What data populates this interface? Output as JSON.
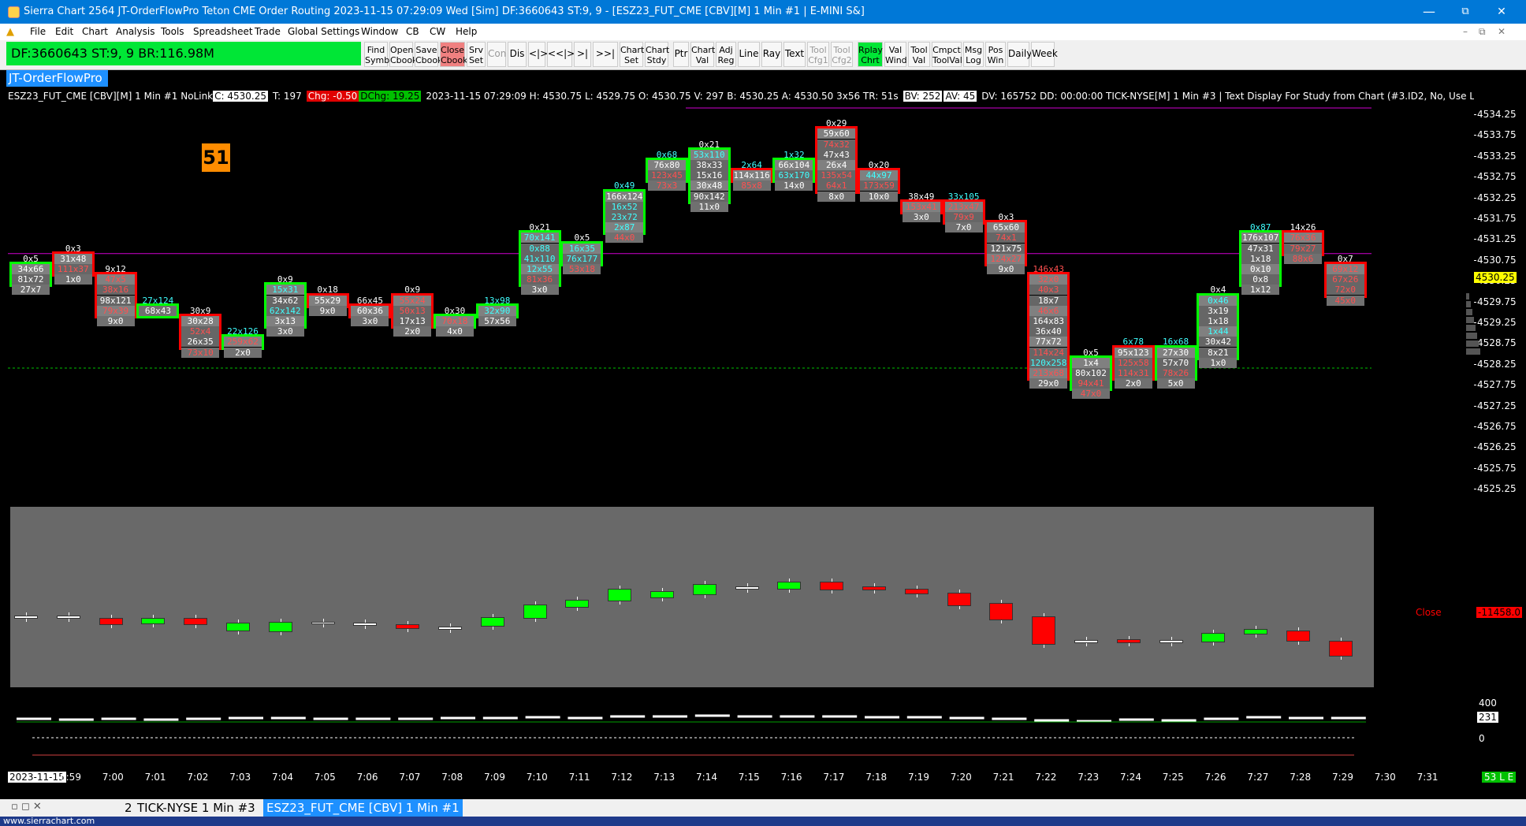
{
  "window": {
    "title": "Sierra Chart 2564 JT-OrderFlowPro Teton CME Order Routing 2023-11-15  07:29:09 Wed [Sim]  DF:3660643  ST:9, 9 - [ESZ23_FUT_CME [CBV][M]  1 Min  #1 | E-MINI S&]",
    "minimize": "—",
    "restore": "⧉",
    "close": "✕"
  },
  "menu": [
    "File",
    "Edit",
    "Chart",
    "Analysis",
    "Tools",
    "Spreadsheet",
    "Trade",
    "Global Settings",
    "Window",
    "CB",
    "CW",
    "Help"
  ],
  "toolbar": {
    "df_status": "DF:3660643  ST:9, 9  BR:116.98M",
    "buttons": [
      {
        "l1": "Find",
        "l2": "Symb"
      },
      {
        "l1": "Open",
        "l2": "Cbook"
      },
      {
        "l1": "Save",
        "l2": "Cbook"
      },
      {
        "l1": "Close",
        "l2": "Cbook"
      },
      {
        "l1": "Srv",
        "l2": "Set"
      },
      {
        "l1": "Con",
        "l2": ""
      },
      {
        "l1": "Dis",
        "l2": ""
      },
      {
        "l1": "<|>",
        "l2": ""
      },
      {
        "l1": "<<|>>",
        "l2": ""
      },
      {
        "l1": ">|<",
        "l2": ""
      },
      {
        "l1": ">>|<<",
        "l2": ""
      },
      {
        "l1": "Chart",
        "l2": "Set"
      },
      {
        "l1": "Chart",
        "l2": "Stdy"
      },
      {
        "l1": "Ptr",
        "l2": ""
      },
      {
        "l1": "Chart",
        "l2": "Val"
      },
      {
        "l1": "Adj",
        "l2": "Reg"
      },
      {
        "l1": "Line",
        "l2": ""
      },
      {
        "l1": "Ray",
        "l2": ""
      },
      {
        "l1": "Text",
        "l2": ""
      },
      {
        "l1": "Tool",
        "l2": "Cfg1"
      },
      {
        "l1": "Tool",
        "l2": "Cfg2"
      },
      {
        "l1": "Rplay",
        "l2": "Chrt"
      },
      {
        "l1": "Val",
        "l2": "Wind"
      },
      {
        "l1": "Tool",
        "l2": "Val"
      },
      {
        "l1": "Cmpct",
        "l2": "ToolVal"
      },
      {
        "l1": "Msg",
        "l2": "Log"
      },
      {
        "l1": "Pos",
        "l2": "Win"
      },
      {
        "l1": "Daily",
        "l2": ""
      },
      {
        "l1": "Week",
        "l2": ""
      }
    ]
  },
  "study_tab": "JT-OrderFlowPro",
  "infobar": {
    "symbol": "ESZ23_FUT_CME [CBV][M]  1 Min  #1 NoLink",
    "c": "C: 4530.25",
    "t": "T: 197",
    "chg": "Chg: -0.50",
    "dchg": "DChg: 19.25",
    "bar": "2023-11-15 07:29:09 H: 4530.75  L: 4529.75  O: 4530.75  V: 297  B: 4530.25  A: 4530.50  3x56  TR: 51s",
    "bv": "BV: 252",
    "av": "AV: 45",
    "rest": "DV: 165752  DD: 00:00:00  TICK-NYSE[M]  1 Min  #3 | Text Display For Study from Chart   (#3.ID2, No, Use Latest Value from"
  },
  "badge": "51",
  "price_axis": [
    "4534.25",
    "4533.75",
    "4533.25",
    "4532.75",
    "4532.25",
    "4531.75",
    "4531.25",
    "4530.75",
    "4530.25",
    "4529.75",
    "4529.25",
    "4528.75",
    "4528.25",
    "4527.75",
    "4527.25",
    "4526.75",
    "4526.25",
    "4525.75",
    "4525.25"
  ],
  "last_price": "4530.25",
  "close_label": "Close",
  "close_value": "-11458.0",
  "lower_axis": [
    "400",
    "231",
    "0"
  ],
  "time_axis": [
    "2023-11-15",
    "6:59",
    "7:00",
    "7:01",
    "7:02",
    "7:03",
    "7:04",
    "7:05",
    "7:06",
    "7:07",
    "7:08",
    "7:09",
    "7:10",
    "7:11",
    "7:12",
    "7:13",
    "7:14",
    "7:15",
    "7:16",
    "7:17",
    "7:18",
    "7:19",
    "7:20",
    "7:21",
    "7:22",
    "7:23",
    "7:24",
    "7:25",
    "7:26",
    "7:27",
    "7:28",
    "7:29",
    "7:30",
    "7:31"
  ],
  "time_badge": "53 L E",
  "tabs": [
    "2",
    "TICK-NYSE  1 Min  #3",
    "ESZ23_FUT_CME [CBV]  1 Min  #1"
  ],
  "status": "www.sierrachart.com",
  "colors": {
    "up": "#00ff00",
    "down": "#ff0000",
    "magenta": "#d000d0",
    "vwap": "#00c000"
  },
  "chart_data": {
    "type": "footprint",
    "bars": [
      {
        "time": "6:58",
        "dir": "up",
        "cells": [
          "0x5",
          "34x66",
          "81x72",
          "27x7"
        ]
      },
      {
        "time": "6:59",
        "dir": "down",
        "cells": [
          "0x3",
          "31x48",
          "111x37",
          "1x0"
        ]
      },
      {
        "time": "7:00",
        "dir": "down",
        "cells": [
          "9x12",
          "47x5",
          "38x16",
          "98x121",
          "79x39",
          "9x0"
        ]
      },
      {
        "time": "7:01",
        "dir": "up",
        "cells": [
          "27x124",
          "68x43"
        ]
      },
      {
        "time": "7:02",
        "dir": "down",
        "cells": [
          "30x9",
          "30x28",
          "52x4",
          "26x35",
          "73x10"
        ]
      },
      {
        "time": "7:03",
        "dir": "up",
        "cells": [
          "22x126",
          "259x62",
          "2x0"
        ]
      },
      {
        "time": "7:04",
        "dir": "up",
        "cells": [
          "0x9",
          "15x31",
          "34x62",
          "62x142",
          "3x13",
          "3x0"
        ]
      },
      {
        "time": "7:05",
        "dir": "down",
        "cells": [
          "0x18",
          "55x29",
          "9x0"
        ]
      },
      {
        "time": "7:06",
        "dir": "down",
        "cells": [
          "66x45",
          "60x36",
          "3x0"
        ]
      },
      {
        "time": "7:07",
        "dir": "down",
        "cells": [
          "0x9",
          "55x24",
          "50x13",
          "17x13",
          "2x0"
        ]
      },
      {
        "time": "7:08",
        "dir": "up",
        "cells": [
          "0x30",
          "70x18",
          "4x0"
        ]
      },
      {
        "time": "7:09",
        "dir": "up",
        "cells": [
          "13x98",
          "32x90",
          "57x56"
        ]
      },
      {
        "time": "7:10",
        "dir": "up",
        "cells": [
          "0x21",
          "70x141",
          "0x88",
          "41x110",
          "12x55",
          "81x36",
          "3x0"
        ]
      },
      {
        "time": "7:11",
        "dir": "up",
        "cells": [
          "0x5",
          "16x35",
          "76x177",
          "53x18"
        ]
      },
      {
        "time": "7:12",
        "dir": "up",
        "cells": [
          "0x49",
          "166x124",
          "16x52",
          "23x72",
          "2x87",
          "44x0"
        ]
      },
      {
        "time": "7:13",
        "dir": "up",
        "cells": [
          "0x68",
          "76x80",
          "123x45",
          "73x3"
        ]
      },
      {
        "time": "7:14",
        "dir": "up",
        "cells": [
          "0x21",
          "53x110",
          "38x33",
          "15x16",
          "30x48",
          "90x142",
          "11x0"
        ]
      },
      {
        "time": "7:15",
        "dir": "down",
        "cells": [
          "2x64",
          "114x116",
          "85x8"
        ]
      },
      {
        "time": "7:16",
        "dir": "up",
        "cells": [
          "1x32",
          "66x104",
          "63x170",
          "14x0"
        ]
      },
      {
        "time": "7:17",
        "dir": "down",
        "cells": [
          "0x29",
          "59x60",
          "74x32",
          "47x43",
          "26x4",
          "135x54",
          "64x1",
          "8x0"
        ]
      },
      {
        "time": "7:18",
        "dir": "down",
        "cells": [
          "0x20",
          "44x97",
          "173x59",
          "10x0"
        ]
      },
      {
        "time": "7:19",
        "dir": "down",
        "cells": [
          "38x49",
          "153x41",
          "3x0"
        ]
      },
      {
        "time": "7:20",
        "dir": "down",
        "cells": [
          "33x105",
          "213x47",
          "79x9",
          "7x0"
        ]
      },
      {
        "time": "7:21",
        "dir": "down",
        "cells": [
          "0x3",
          "65x60",
          "74x1",
          "121x75",
          "124x27",
          "9x0"
        ]
      },
      {
        "time": "7:22",
        "dir": "down",
        "cells": [
          "146x43",
          "32x0",
          "40x3",
          "18x7",
          "46x6",
          "164x83",
          "36x40",
          "77x72",
          "114x24",
          "120x258",
          "213x68",
          "29x0"
        ]
      },
      {
        "time": "7:23",
        "dir": "up",
        "cells": [
          "0x5",
          "1x4",
          "80x102",
          "94x41",
          "47x0"
        ]
      },
      {
        "time": "7:24",
        "dir": "down",
        "cells": [
          "6x78",
          "95x123",
          "125x58",
          "114x31",
          "2x0"
        ]
      },
      {
        "time": "7:25",
        "dir": "up",
        "cells": [
          "16x68",
          "27x30",
          "57x70",
          "78x26",
          "5x0"
        ]
      },
      {
        "time": "7:26",
        "dir": "up",
        "cells": [
          "0x4",
          "0x46",
          "3x19",
          "1x18",
          "1x44",
          "30x42",
          "8x21",
          "1x0"
        ]
      },
      {
        "time": "7:27",
        "dir": "up",
        "cells": [
          "0x87",
          "176x107",
          "47x31",
          "1x18",
          "0x10",
          "0x8",
          "1x12"
        ]
      },
      {
        "time": "7:28",
        "dir": "down",
        "cells": [
          "14x26",
          "76x36",
          "79x27",
          "88x6"
        ]
      },
      {
        "time": "7:29",
        "dir": "down",
        "cells": [
          "0x7",
          "69x12",
          "67x26",
          "72x0",
          "45x0"
        ]
      }
    ]
  }
}
